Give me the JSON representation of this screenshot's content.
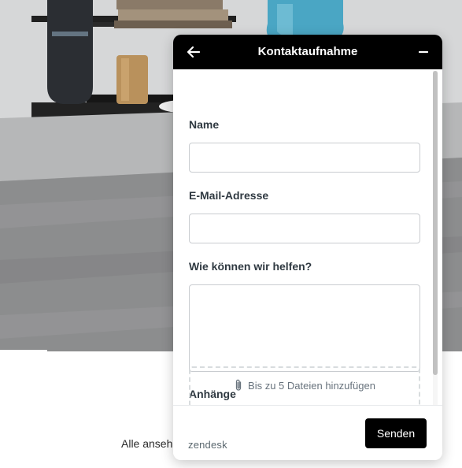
{
  "page": {
    "link_text": "Alle anseh"
  },
  "widget": {
    "header": {
      "title": "Kontaktaufnahme",
      "back_icon": "arrow-left-icon",
      "minimize_icon": "minus-icon"
    },
    "form": {
      "name_label": "Name",
      "email_label": "E-Mail-Adresse",
      "message_label": "Wie können wir helfen?",
      "attachments_label": "Anhänge",
      "dropzone_text": "Bis zu 5 Dateien hinzufügen",
      "name_value": "",
      "email_value": "",
      "message_value": ""
    },
    "footer": {
      "brand": "zendesk",
      "send_label": "Senden"
    }
  },
  "colors": {
    "header_bg": "#000000",
    "header_text": "#ffffff",
    "label_text": "#2f3941",
    "input_border": "#c9ccd0",
    "button_bg": "#000000",
    "button_text": "#ffffff"
  }
}
